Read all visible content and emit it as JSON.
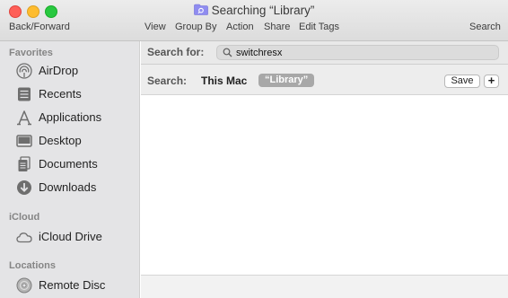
{
  "window": {
    "title": "Searching “Library”"
  },
  "toolbar": {
    "back_forward": "Back/Forward",
    "view": "View",
    "group_by": "Group By",
    "action": "Action",
    "share": "Share",
    "edit_tags": "Edit Tags",
    "search": "Search"
  },
  "sidebar": {
    "favorites_header": "Favorites",
    "favorites": [
      {
        "label": "AirDrop",
        "icon": "airdrop-icon"
      },
      {
        "label": "Recents",
        "icon": "recents-icon"
      },
      {
        "label": "Applications",
        "icon": "applications-icon"
      },
      {
        "label": "Desktop",
        "icon": "desktop-icon"
      },
      {
        "label": "Documents",
        "icon": "documents-icon"
      },
      {
        "label": "Downloads",
        "icon": "downloads-icon"
      }
    ],
    "icloud_header": "iCloud",
    "icloud": [
      {
        "label": "iCloud Drive",
        "icon": "cloud-icon"
      }
    ],
    "locations_header": "Locations",
    "locations": [
      {
        "label": "Remote Disc",
        "icon": "disc-icon"
      }
    ]
  },
  "search": {
    "for_label": "Search for:",
    "query": "switchresx",
    "scope_label": "Search:",
    "scope_this_mac": "This Mac",
    "scope_library": "“Library”",
    "save_label": "Save",
    "add_label": "+"
  },
  "colors": {
    "close": "#fe5f57",
    "minimize": "#febc2e",
    "maximize": "#28c840",
    "sidebar_bg": "#e4e4e6",
    "scope_selected_bg": "#a8a8a8"
  }
}
